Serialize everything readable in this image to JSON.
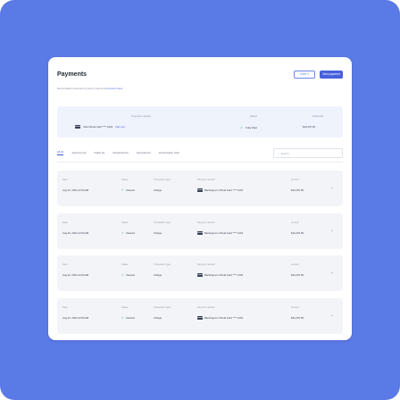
{
  "header": {
    "title": "Payments",
    "more_label": "More",
    "new_label": "New payment"
  },
  "caption": {
    "text": "Reconciliation powered by Quarry payments",
    "link": "Account notes"
  },
  "summary": {
    "method_label": "Payment method",
    "method_value": "Visa Virtual Card **** 1234",
    "method_link": "Add new",
    "status_label": "Status",
    "status_value": "Fully Paid",
    "total_label": "Total paid",
    "total_value": "$19,470.00"
  },
  "tabs": [
    {
      "label": "All (4)",
      "active": true
    },
    {
      "label": "Approved (4)",
      "active": false
    },
    {
      "label": "Failed (0)",
      "active": false
    },
    {
      "label": "Scheduled (0)",
      "active": false
    },
    {
      "label": "Canceled (0)",
      "active": false
    },
    {
      "label": "Authorization Hold",
      "active": false
    }
  ],
  "search": {
    "placeholder": "Search"
  },
  "columns": {
    "date": "Date",
    "status": "Status",
    "type": "Transaction type",
    "method": "Payment method",
    "amount": "Amount"
  },
  "rows": [
    {
      "date": "Aug 22, 2024 12:00 AM",
      "status": "Cleared",
      "type": "Charge",
      "method": "Bankingcom Virtual Card **** 1234",
      "amount": "$19,470.00"
    },
    {
      "date": "Aug 22, 2024 12:00 AM",
      "status": "Cleared",
      "type": "Charge",
      "method": "Bankingcom Virtual Card **** 1234",
      "amount": "$19,470.00"
    },
    {
      "date": "Aug 22, 2024 12:00 AM",
      "status": "Cleared",
      "type": "Charge",
      "method": "Bankingcom Virtual Card **** 1234",
      "amount": "$19,470.00"
    },
    {
      "date": "Aug 22, 2024 12:00 AM",
      "status": "Cleared",
      "type": "Charge",
      "method": "Bankingcom Virtual Card **** 1234",
      "amount": "$19,470.00"
    }
  ],
  "colors": {
    "background": "#5a7ae6",
    "primary": "#4760dc",
    "success": "#2f9a5a"
  }
}
